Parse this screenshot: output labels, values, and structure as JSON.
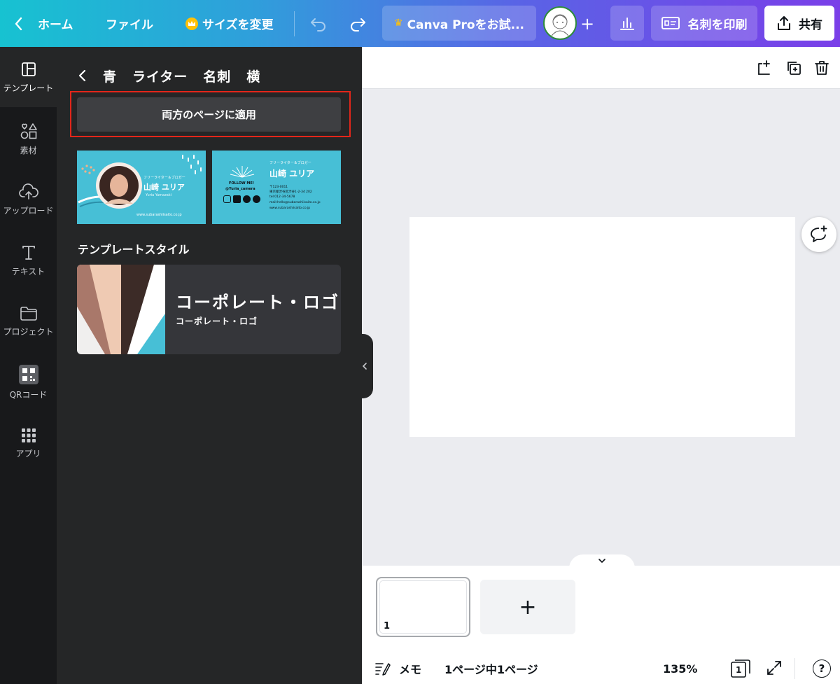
{
  "topbar": {
    "home_label": "ホーム",
    "file_label": "ファイル",
    "resize_label": "サイズを変更",
    "pro_trial_label": "Canva Proをお試...",
    "print_label": "名刺を印刷",
    "share_label": "共有"
  },
  "rail": {
    "items": [
      {
        "label": "テンプレート",
        "icon": "template-icon"
      },
      {
        "label": "素材",
        "icon": "elements-icon"
      },
      {
        "label": "アップロード",
        "icon": "upload-icon"
      },
      {
        "label": "テキスト",
        "icon": "text-icon"
      },
      {
        "label": "プロジェクト",
        "icon": "folder-icon"
      },
      {
        "label": "QRコード",
        "icon": "qr-code-icon"
      },
      {
        "label": "アプリ",
        "icon": "apps-icon"
      }
    ]
  },
  "panel": {
    "breadcrumb": [
      "青",
      "ライター",
      "名刺",
      "横"
    ],
    "apply_label": "両方のページに適用",
    "front_card": {
      "role": "フリーライター＆ブロガー",
      "name": "山崎 ユリア",
      "romaji": "Yuria Yamazaki",
      "url": "www.subarashiisaito.co.jp"
    },
    "back_card": {
      "follow": "FOLLOW ME!",
      "handle": "@Yuria_camera",
      "role": "フリーライター＆ブロガー",
      "name": "山崎 ユリア",
      "postal": "〒123-0011",
      "address": "東京都渋谷区渋谷1-2-34 202",
      "tel": "tel:012-34-5678",
      "mail": "mail:hello@subarashiisaito.co.jp",
      "url": "www.subarashiisaito.co.jp"
    },
    "style_section_title": "テンプレートスタイル",
    "style_card": {
      "title": "コーポレート・ロゴ",
      "subtitle": "コーポレート・ロゴ"
    }
  },
  "footer": {
    "page_thumb_number": "1",
    "add_page_label": "+",
    "memo_label": "メモ",
    "page_status": "1ページ中1ページ",
    "zoom": "135%",
    "page_count_badge": "1",
    "help_label": "?"
  },
  "colors": {
    "topbar_gradient_start": "#17c2d1",
    "topbar_gradient_end": "#7a3fe8",
    "panel_bg": "#252627",
    "rail_bg": "#18191b",
    "highlight_box": "#e3261a",
    "card_teal": "#47bfd6"
  }
}
